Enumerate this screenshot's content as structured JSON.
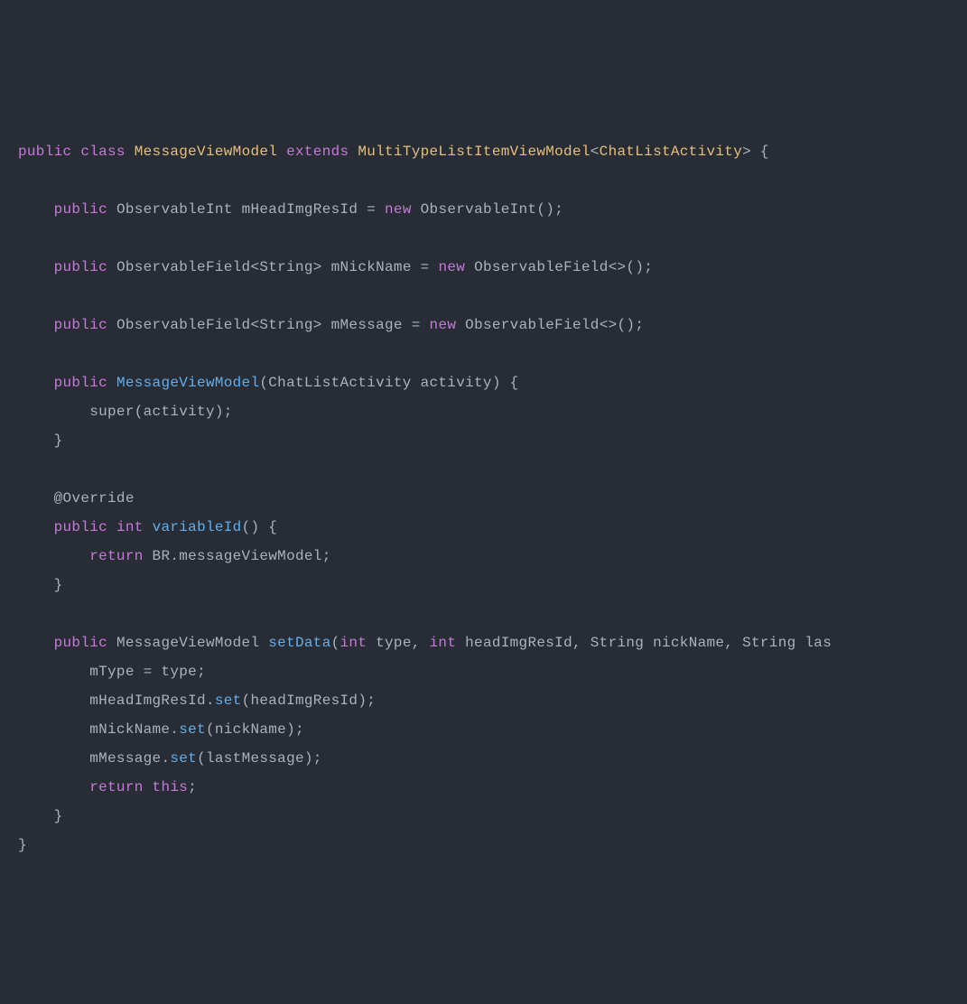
{
  "code": {
    "kw_public": "public",
    "kw_class": "class",
    "kw_extends": "extends",
    "kw_new": "new",
    "kw_return": "return",
    "kw_this": "this",
    "kw_int": "int",
    "kw_super": "super",
    "classname_main": "MessageViewModel",
    "classname_super": "MultiTypeListItemViewModel",
    "generic_type": "ChatListActivity",
    "type_observableint": "ObservableInt",
    "type_observablefield": "ObservableField",
    "type_string": "String",
    "field_head": "mHeadImgResId",
    "field_nick": "mNickName",
    "field_msg": "mMessage",
    "field_type": "mType",
    "ctor_param": "ChatListActivity activity",
    "ctor_arg": "activity",
    "annotation_override": "@Override",
    "method_variableid": "variableId",
    "br_ref": "BR.messageViewModel",
    "method_setdata": "setData",
    "setdata_params": "int type, int headImgResId, String nickName, String las",
    "method_set": "set",
    "arg_head": "headImgResId",
    "arg_nick": "nickName",
    "arg_msg": "lastMessage",
    "arg_type": "type",
    "open_brace": "{",
    "close_brace": "}",
    "semicolon": ";",
    "paren_open": "(",
    "paren_close": ")",
    "angle_open": "<",
    "angle_close": ">",
    "angle_empty": "<>",
    "equals": " = ",
    "dot": "."
  }
}
